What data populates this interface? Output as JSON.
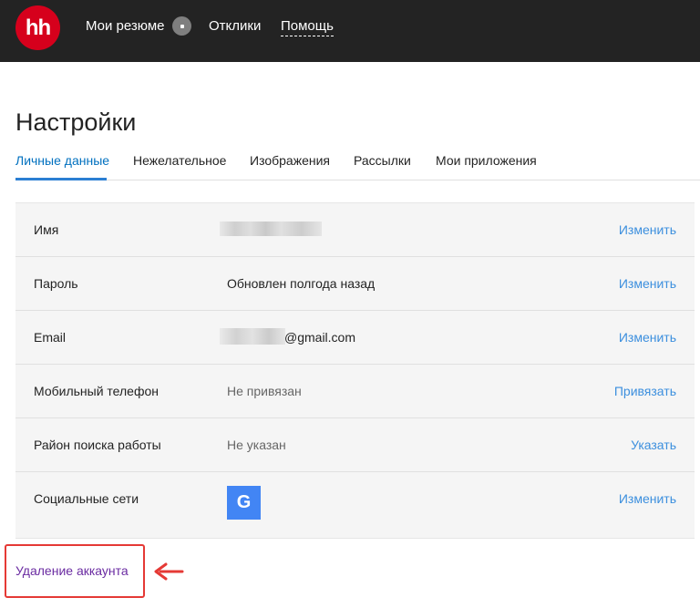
{
  "header": {
    "logo_text": "hh",
    "nav": {
      "resume": "Мои резюме",
      "responses": "Отклики",
      "help": "Помощь"
    }
  },
  "page": {
    "title": "Настройки"
  },
  "tabs": [
    {
      "label": "Личные данные",
      "active": true
    },
    {
      "label": "Нежелательное",
      "active": false
    },
    {
      "label": "Изображения",
      "active": false
    },
    {
      "label": "Рассылки",
      "active": false
    },
    {
      "label": "Мои приложения",
      "active": false
    }
  ],
  "settings": {
    "rows": [
      {
        "label": "Имя",
        "value": "",
        "action": "Изменить"
      },
      {
        "label": "Пароль",
        "value": "Обновлен полгода назад",
        "action": "Изменить"
      },
      {
        "label": "Email",
        "value": "@gmail.com",
        "action": "Изменить"
      },
      {
        "label": "Мобильный телефон",
        "value": "Не привязан",
        "action": "Привязать"
      },
      {
        "label": "Район поиска работы",
        "value": "Не указан",
        "action": "Указать"
      },
      {
        "label": "Социальные сети",
        "value": "G",
        "action": "Изменить"
      }
    ]
  },
  "footer": {
    "delete_account": "Удаление аккаунта"
  },
  "colors": {
    "header_bg": "#232323",
    "brand_red": "#d6001c",
    "link_blue": "#3c8fde",
    "active_tab": "#0070bf",
    "google_blue": "#4285f4",
    "highlight_red": "#e53935",
    "delete_link": "#6a2ba1"
  },
  "icons": {
    "badge": "dot-badge-icon",
    "social": "google-icon",
    "annotation": "red-arrow-icon"
  }
}
